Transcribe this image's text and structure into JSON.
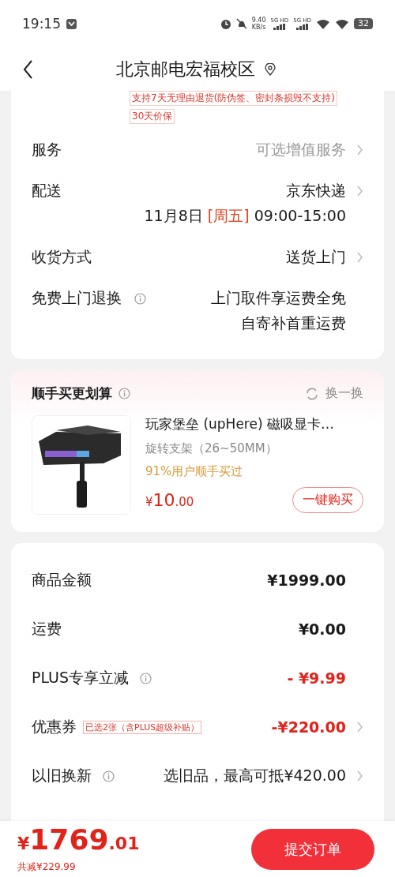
{
  "status_bar": {
    "time": "19:15",
    "net_speed": "9.40",
    "net_unit": "KB/s",
    "sim_labels": [
      "5G HD",
      "5G HD"
    ],
    "battery": "32"
  },
  "header": {
    "title": "北京邮电宏福校区"
  },
  "service_card": {
    "tags": [
      "支持7天无理由退货(防伪签、密封条损毁不支持)",
      "30天价保"
    ],
    "rows": [
      {
        "label": "服务",
        "info": false,
        "values": [
          "可选增值服务"
        ],
        "muted": true,
        "chevron": true
      },
      {
        "label": "配送",
        "info": false,
        "values": [
          "京东快递"
        ],
        "muted": false,
        "chevron": true,
        "schedule": {
          "date": "11月8日",
          "weekday": "[周五]",
          "time": "09:00-15:00"
        }
      },
      {
        "label": "收货方式",
        "info": false,
        "values": [
          "送货上门"
        ],
        "muted": false,
        "chevron": true
      },
      {
        "label": "免费上门退换",
        "info": true,
        "values": [
          "上门取件享运费全免",
          "自寄补首重运费"
        ],
        "muted": false,
        "chevron": false
      }
    ]
  },
  "upsell_card": {
    "title": "顺手买更划算",
    "refresh": "换一换",
    "product": {
      "kind": "picture",
      "name": "玩家堡垒 (upHere) 磁吸显卡…",
      "spec": "旋转支架（26~50MM）",
      "note": "91%用户顺手买过",
      "currency": "¥",
      "price_int": "10",
      "price_dec": ".00",
      "button": "一键购买"
    }
  },
  "price_card": {
    "rows": [
      {
        "label": "商品金额",
        "info": false,
        "value": "¥1999.00",
        "kind": "normal",
        "chevron": false
      },
      {
        "label": "运费",
        "info": false,
        "value": "¥0.00",
        "kind": "normal",
        "chevron": false
      },
      {
        "label": "PLUS专享立减",
        "info": true,
        "value": "- ¥9.99",
        "kind": "discount",
        "chevron": false
      },
      {
        "label": "优惠券",
        "info": false,
        "badge": "已选2张（含PLUS超级补贴）",
        "value": "-¥220.00",
        "kind": "discount",
        "chevron": true
      },
      {
        "label": "以旧换新",
        "info": true,
        "value": "选旧品，最高可抵¥420.00",
        "kind": "normal",
        "chevron": true
      }
    ]
  },
  "bottom_bar": {
    "currency": "¥",
    "total_int": "1769",
    "total_dec": ".01",
    "saved": "共减¥229.99",
    "submit": "提交订单"
  }
}
